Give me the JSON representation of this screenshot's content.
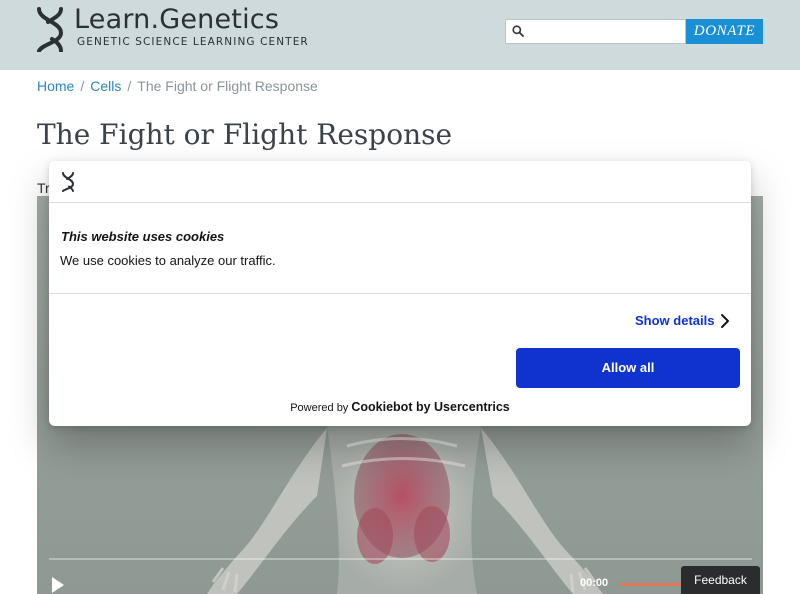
{
  "header": {
    "logo_text": "Learn.Genetics",
    "logo_subtitle": "GENETIC SCIENCE LEARNING CENTER",
    "search_placeholder": "",
    "donate_label": "DONATE"
  },
  "breadcrumb": {
    "home": "Home",
    "cells": "Cells",
    "current": "The Fight or Flight Response",
    "separator": "/"
  },
  "page": {
    "title": "The Fight or Flight Response",
    "intro_fragment": "Tr"
  },
  "video": {
    "time": "00:00",
    "icons": [
      "play-icon"
    ]
  },
  "cookie_banner": {
    "title": "This website uses cookies",
    "text": "We use cookies to analyze our traffic.",
    "show_details": "Show details",
    "allow_all": "Allow all",
    "powered_prefix": "Powered by",
    "powered_brand": "Cookiebot by Usercentrics"
  },
  "feedback": {
    "label": "Feedback"
  },
  "colors": {
    "header_bg": "#cfdadd",
    "link": "#2a85c7",
    "donate_bg": "#1b8fd3",
    "cookie_accent": "#1032cf"
  }
}
